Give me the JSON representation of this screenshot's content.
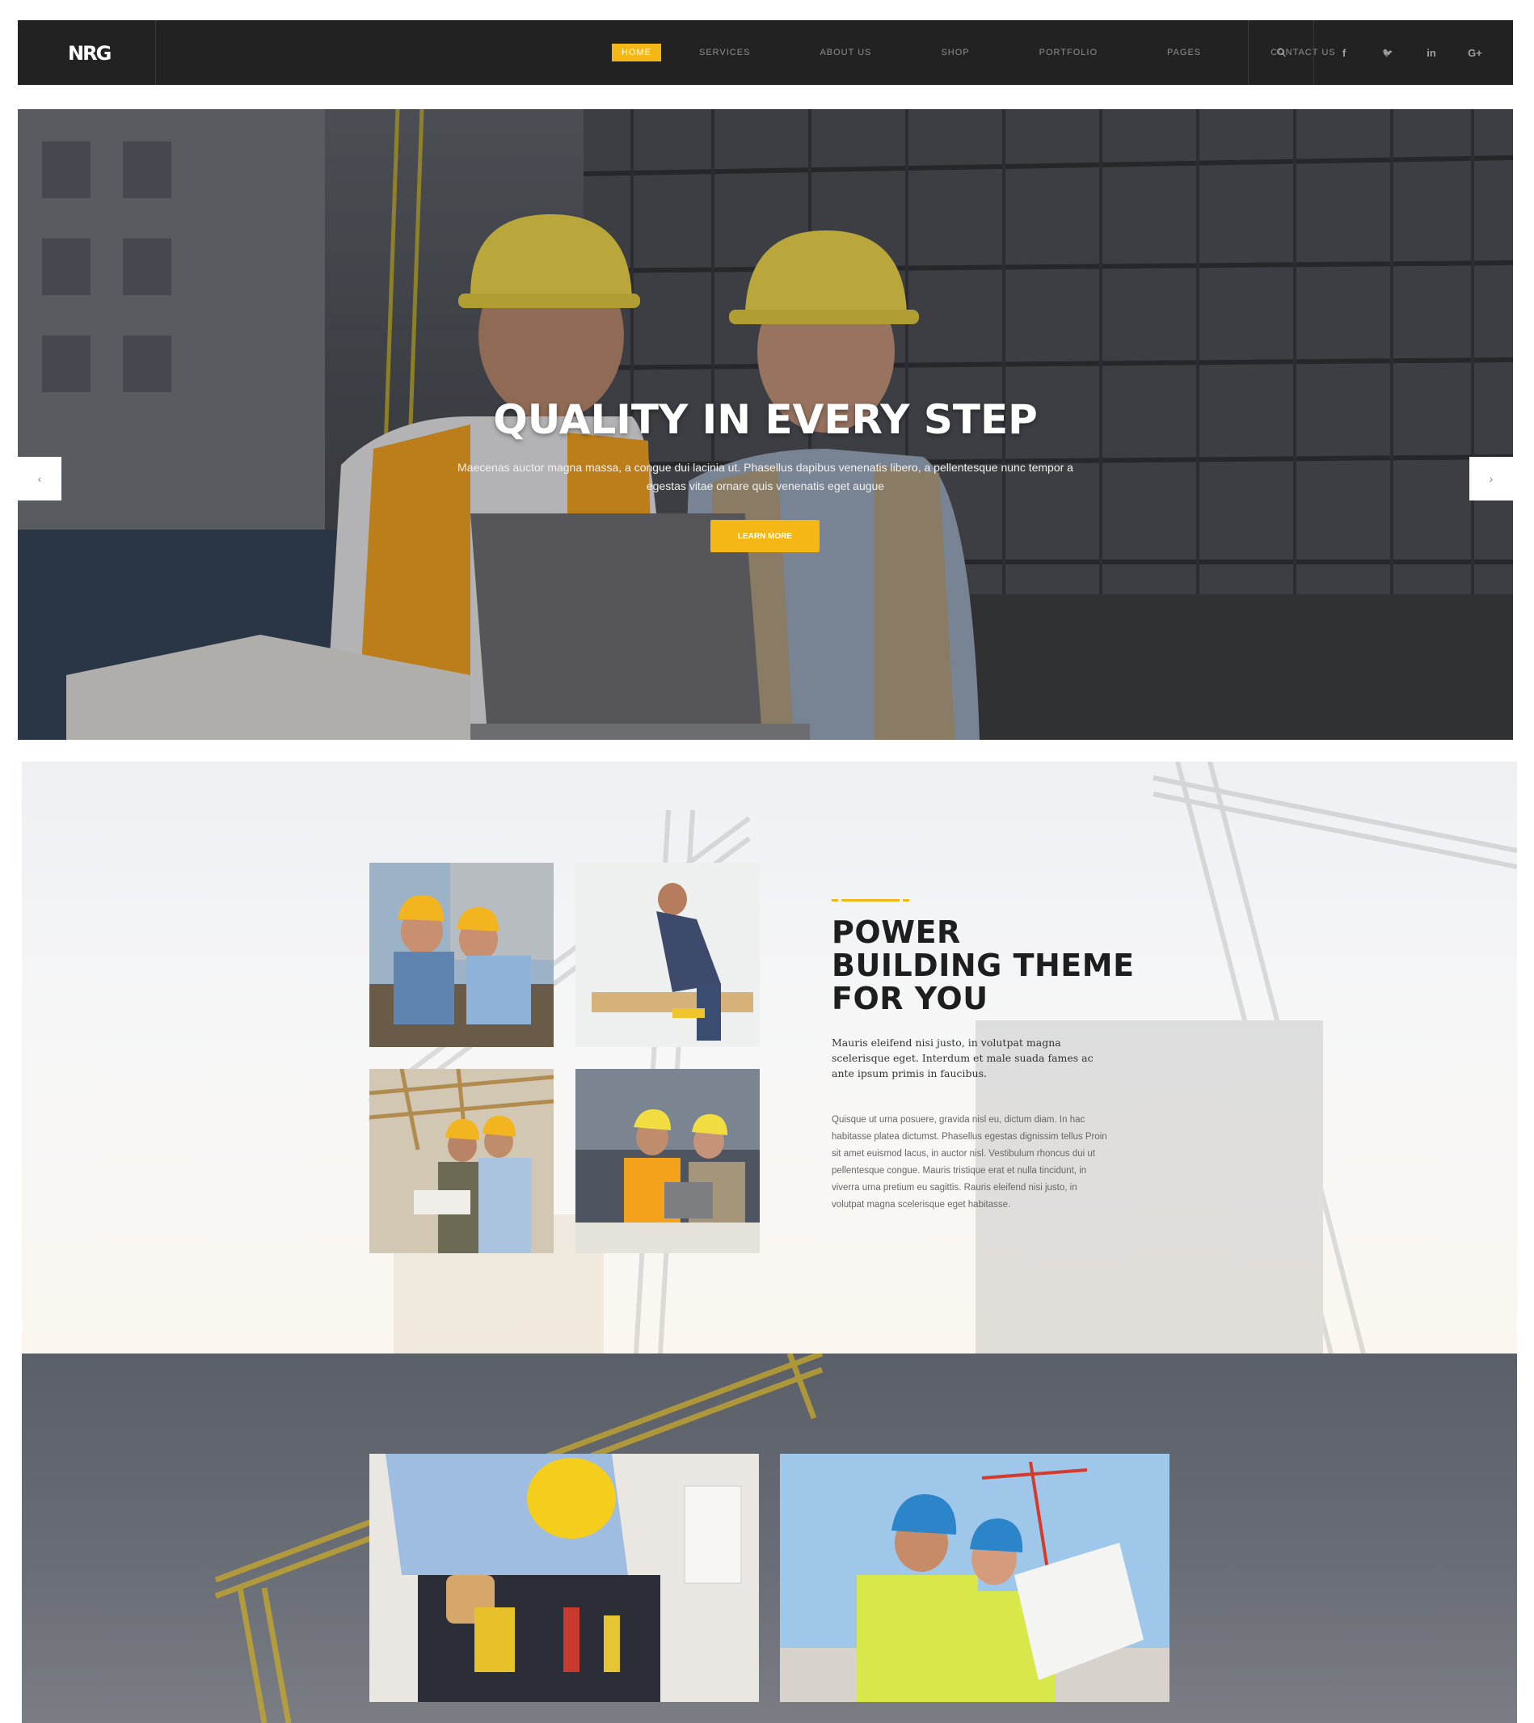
{
  "brand": {
    "logo_text": "NRG",
    "accent_color": "#f4b715",
    "dark_color": "#222222"
  },
  "nav": {
    "items": [
      {
        "label": "HOME",
        "active": true
      },
      {
        "label": "SERVICES",
        "active": false
      },
      {
        "label": "ABOUT US",
        "active": false
      },
      {
        "label": "SHOP",
        "active": false
      },
      {
        "label": "PORTFOLIO",
        "active": false
      },
      {
        "label": "PAGES",
        "active": false
      },
      {
        "label": "CONTACT US",
        "active": false
      }
    ],
    "icons": [
      "search-icon",
      "facebook-icon",
      "twitter-icon",
      "linkedin-icon",
      "google-plus-icon"
    ],
    "icon_glyphs": {
      "search": "⚲",
      "facebook": "f",
      "twitter": "🐦",
      "linkedin": "in",
      "google_plus": "G+"
    }
  },
  "hero": {
    "title": "QUALITY IN EVERY STEP",
    "text": "Maecenas auctor magna massa, a congue dui lacinia ut. Phasellus dapibus venenatis libero, a pellentesque nunc tempor a egestas vitae ornare quis venenatis eget augue",
    "button_label": "LEARN MORE",
    "prev_arrow": "‹",
    "next_arrow": "›"
  },
  "about": {
    "title_lines": [
      "POWER",
      "BUILDING THEME",
      "FOR YOU"
    ],
    "lead": "Mauris eleifend nisi justo, in volutpat magna scelerisque eget. Interdum et male suada fames ac ante ipsum primis in faucibus.",
    "body": "Quisque ut urna posuere, gravida nisl eu, dictum diam. In hac habitasse platea dictumst. Phasellus egestas dignissim tellus Proin sit amet euismod lacus, in auctor nisl. Vestibulum rhoncus dui ut pellentesque congue. Mauris tristique erat et nulla tincidunt, in viverra urna pretium eu sagittis. Rauris eleifend nisi justo, in volutpat magna scelerisque eget habitasse."
  }
}
